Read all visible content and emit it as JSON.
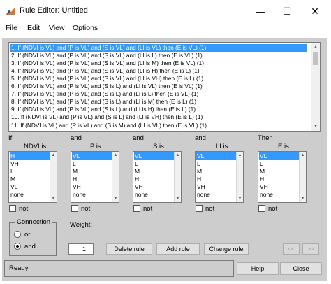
{
  "window": {
    "title": "Rule Editor: Untitled"
  },
  "controls": {
    "minimize": "—",
    "maximize": "☐",
    "close": "✕"
  },
  "menu": [
    "File",
    "Edit",
    "View",
    "Options"
  ],
  "rules": [
    "1. If (NDVI is VL) and (P is VL) and (S is VL) and (LI is VL) then (E is VL) (1)",
    "2. If (NDVI is VL) and (P is VL) and (S is VL) and (LI is L) then (E is VL) (1)",
    "3. If (NDVI is VL) and (P is VL) and (S is VL) and (LI is M) then (E is VL) (1)",
    "4. If (NDVI is VL) and (P is VL) and (S is VL) and (LI is H) then (E is L) (1)",
    "5. If (NDVI is VL) and (P is VL) and (S is VL) and (LI is VH) then (E is L) (1)",
    "6. If (NDVI is VL) and (P is VL) and (S is L) and (LI is VL) then (E is VL) (1)",
    "7. If (NDVI is VL) and (P is VL) and (S is L) and (LI is L) then (E is VL) (1)",
    "8. If (NDVI is VL) and (P is VL) and (S is L) and (LI is M) then (E is L) (1)",
    "9. If (NDVI is VL) and (P is VL) and (S is L) and (LI is H) then (E is L) (1)",
    "10. If (NDVI is VL) and (P is VL) and (S is L) and (LI is VH) then (E is L) (1)",
    "11. If (NDVI is VL) and (P is VL) and (S is M) and (LI is VL) then (E is VL) (1)"
  ],
  "selected_rule": 0,
  "columns": [
    {
      "connector": "If",
      "label": "NDVI is",
      "options": [
        "H",
        "VH",
        "L",
        "M",
        "VL",
        "none"
      ],
      "selected": 0,
      "not_label": "not"
    },
    {
      "connector": "and",
      "label": "P is",
      "options": [
        "VL",
        "L",
        "M",
        "H",
        "VH",
        "none"
      ],
      "selected": 0,
      "not_label": "not"
    },
    {
      "connector": "and",
      "label": "S is",
      "options": [
        "VL",
        "L",
        "M",
        "H",
        "VH",
        "none"
      ],
      "selected": 0,
      "not_label": "not"
    },
    {
      "connector": "and",
      "label": "LI is",
      "options": [
        "VL",
        "L",
        "M",
        "H",
        "VH",
        "none"
      ],
      "selected": 0,
      "not_label": "not"
    },
    {
      "connector": "Then",
      "label": "E is",
      "options": [
        "VL",
        "L",
        "M",
        "H",
        "VH",
        "none"
      ],
      "selected": 0,
      "not_label": "not"
    }
  ],
  "connection": {
    "title": "Connection",
    "options": [
      "or",
      "and"
    ],
    "selected": 1
  },
  "weight": {
    "label": "Weight:",
    "value": "1"
  },
  "buttons": {
    "delete_rule": "Delete rule",
    "add_rule": "Add rule",
    "change_rule": "Change rule",
    "prev": "<<",
    "next": ">>",
    "help": "Help",
    "close": "Close"
  },
  "status": "Ready",
  "colors": {
    "selection": "#3399ff",
    "panel": "#cdcdcd"
  }
}
